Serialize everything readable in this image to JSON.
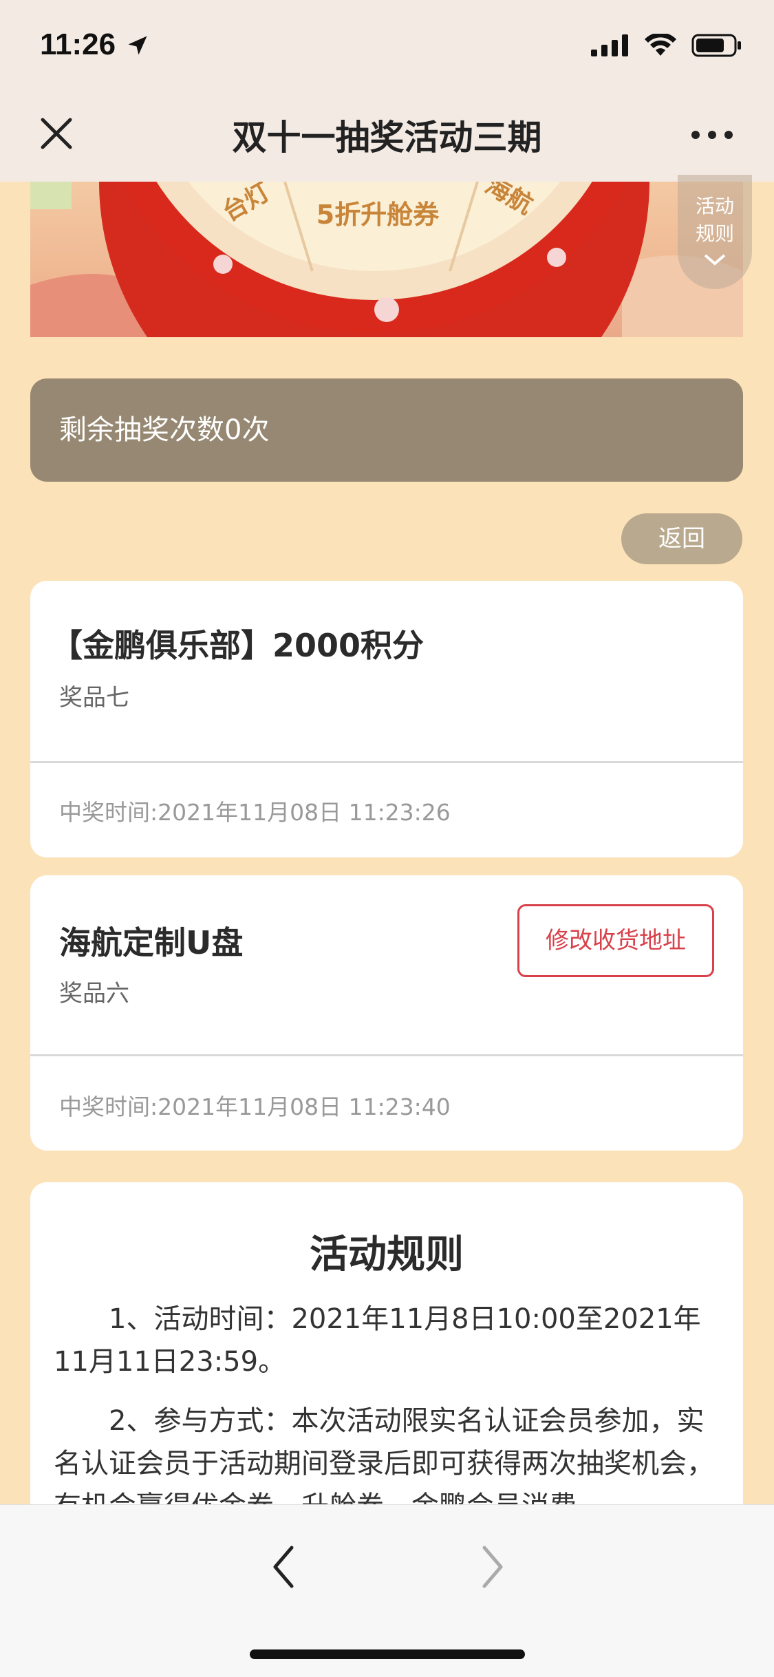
{
  "status_bar": {
    "time": "11:26"
  },
  "nav": {
    "title": "双十一抽奖活动三期"
  },
  "banner": {
    "wheel_left_text": "台灯",
    "wheel_center_text": "5折升舱券",
    "wheel_right_text": "海航"
  },
  "rules_fab": {
    "line1": "活动",
    "line2": "规则"
  },
  "remaining_draws": "剩余抽奖次数0次",
  "back_button": "返回",
  "prizes": [
    {
      "name": "【金鹏俱乐部】2000积分",
      "level": "奖品七",
      "time": "中奖时间:2021年11月08日 11:23:26"
    },
    {
      "name": "海航定制U盘",
      "level": "奖品六",
      "time": "中奖时间:2021年11月08日 11:23:40",
      "action": "修改收货地址"
    }
  ],
  "rules": {
    "title": "活动规则",
    "item1": "1、活动时间：2021年11月8日10:00至2021年11月11日23:59。",
    "item2": "2、参与方式：本次活动限实名认证会员参加，实名认证会员于活动期间登录后即可获得两次抽奖机会，有机会赢得优金券、升舱券、金鹏会员消费"
  }
}
